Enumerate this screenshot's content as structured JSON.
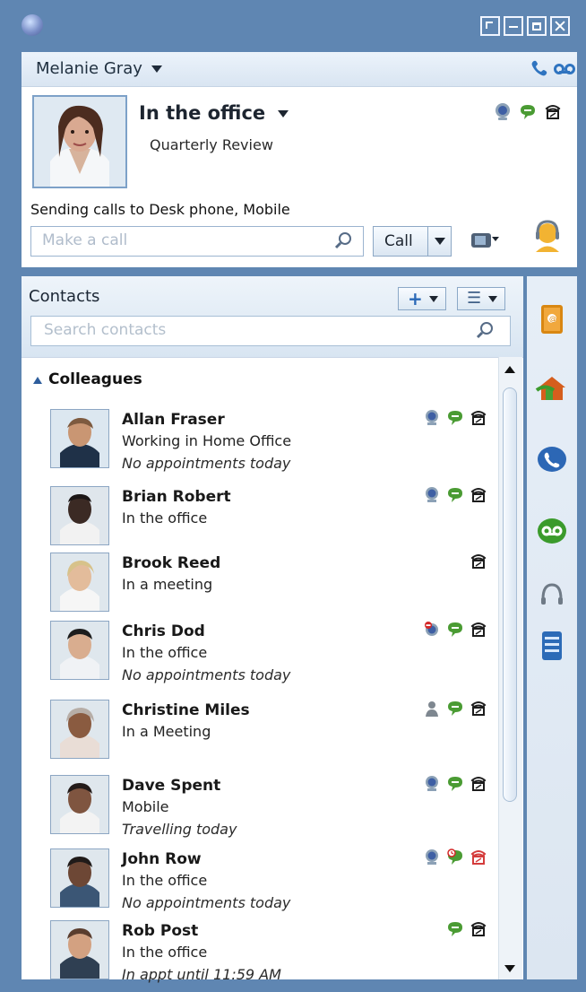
{
  "window": {
    "controls": [
      "tool",
      "minimize",
      "maximize",
      "close"
    ]
  },
  "profile": {
    "user_name": "Melanie Gray",
    "status_title": "In the office",
    "status_subtitle": "Quarterly Review",
    "forwarding_text": "Sending calls to Desk phone, Mobile",
    "make_call_placeholder": "Make a call",
    "call_button_label": "Call",
    "accent_phone": "#2f74c0"
  },
  "contacts": {
    "title": "Contacts",
    "search_placeholder": "Search contacts",
    "group_name": "Colleagues",
    "items": [
      {
        "name": "Allan Fraser",
        "line1": "Working in Home Office",
        "line2": "No appointments today"
      },
      {
        "name": "Brian Robert",
        "line1": "In the office",
        "line2": ""
      },
      {
        "name": "Brook Reed",
        "line1": "In a meeting",
        "line2": ""
      },
      {
        "name": "Chris Dod",
        "line1": "In the office",
        "line2": "No appointments today"
      },
      {
        "name": "Christine Miles",
        "line1": "In a Meeting",
        "line2": ""
      },
      {
        "name": "Dave Spent",
        "line1": "Mobile",
        "line2": "Travelling today"
      },
      {
        "name": "John Row",
        "line1": "In the office",
        "line2": "No appointments today"
      },
      {
        "name": "Rob Post",
        "line1": "In the office",
        "line2": "In appt until 11:59 AM"
      }
    ]
  },
  "side_rail": {
    "icons": [
      "address-book-icon",
      "home-transfer-icon",
      "call-icon",
      "voicemail-icon",
      "headset-icon",
      "list-icon"
    ]
  }
}
